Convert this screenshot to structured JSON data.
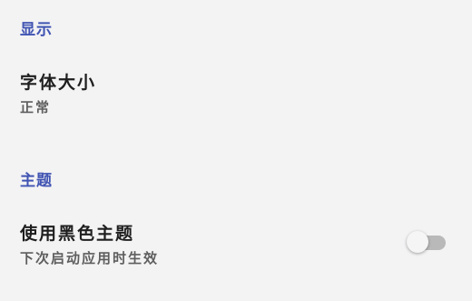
{
  "sections": [
    {
      "title": "显示",
      "items": [
        {
          "title": "字体大小",
          "summary": "正常"
        }
      ]
    },
    {
      "title": "主题",
      "items": [
        {
          "title": "使用黑色主题",
          "summary": "下次启动应用时生效",
          "switch_on": false
        }
      ]
    }
  ],
  "colors": {
    "section_title": "#4054b2",
    "background": "#f3f3f4"
  }
}
